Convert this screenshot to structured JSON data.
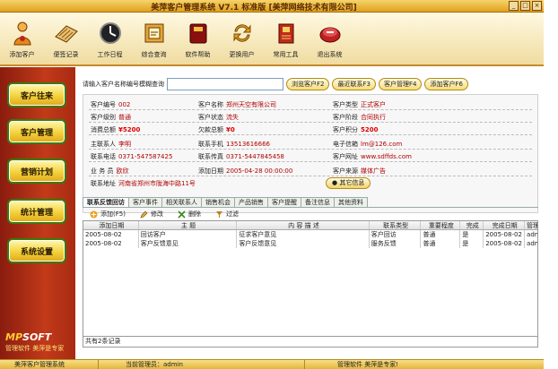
{
  "window": {
    "title": "美萍客户管理系统 V7.1 标准版 [美萍网络技术有限公司]",
    "controls": [
      "_",
      "□",
      "×"
    ]
  },
  "toolbar": [
    {
      "label": "添加客户",
      "icon": "person-icon"
    },
    {
      "label": "便签记录",
      "icon": "memo-icon"
    },
    {
      "label": "工作日程",
      "icon": "schedule-icon"
    },
    {
      "label": "综合查询",
      "icon": "query-icon"
    },
    {
      "label": "软件帮助",
      "icon": "help-book-icon"
    },
    {
      "label": "更换用户",
      "icon": "switch-user-icon"
    },
    {
      "label": "常用工具",
      "icon": "tools-icon"
    },
    {
      "label": "退出系统",
      "icon": "exit-icon"
    }
  ],
  "nav": [
    "客户往来",
    "客户管理",
    "营销计划",
    "统计管理",
    "系统设置"
  ],
  "logo": {
    "brand_mp": "MP",
    "brand_soft": "SOFT",
    "slogan": "管理软件 美萍是专家"
  },
  "search": {
    "label": "请输入客户名称编号模糊查询",
    "value": "",
    "buttons": [
      "浏览客户F2",
      "最近联系F3",
      "客户管理F4",
      "添加客户F6"
    ]
  },
  "customer": {
    "code_k": "客户编号",
    "code_v": "002",
    "name_k": "客户名称",
    "name_v": "郑州天空有限公司",
    "type_k": "客户类型",
    "type_v": "正式客户",
    "level_k": "客户级别",
    "level_v": "普通",
    "status_k": "客户状态",
    "status_v": "流失",
    "stage_k": "客户阶段",
    "stage_v": "合同执行",
    "spend_k": "消费总额",
    "spend_v": "¥5200",
    "owe_k": "欠款总额",
    "owe_v": "¥0",
    "points_k": "客户积分",
    "points_v": "5200",
    "contact_k": "主联系人",
    "contact_v": "李明",
    "phone_k": "联系手机",
    "phone_v": "13513616666",
    "email_k": "电子信箱",
    "email_v": "lm@126.com",
    "tel_k": "联系电话",
    "tel_v": "0371-547587425",
    "fax_k": "联系传真",
    "fax_v": "0371-5447845458",
    "web_k": "客户网址",
    "web_v": "www.sdffds.com",
    "sales_k": "业 务 员",
    "sales_v": "欧欣",
    "date_k": "添加日期",
    "date_v": "2005-04-28 00:00:00",
    "source_k": "客户来源",
    "source_v": "媒体广告",
    "addr_k": "联系地址",
    "addr_v": "河南省郑州市陇海中路11号",
    "other_btn": "其它信息"
  },
  "tabs": [
    "联系反馈回访",
    "客户事件",
    "相关联系人",
    "销售机会",
    "产品销售",
    "客户提醒",
    "备注信息",
    "其他资料"
  ],
  "grid_tools": [
    {
      "label": "添加(F5)",
      "icon": "add-icon"
    },
    {
      "label": "修改",
      "icon": "edit-icon"
    },
    {
      "label": "删除",
      "icon": "delete-icon"
    },
    {
      "label": "过滤",
      "icon": "filter-icon"
    }
  ],
  "grid": {
    "columns": [
      "添加日期",
      "主  题",
      "内 容 描 述",
      "联系类型",
      "重要程度",
      "完成",
      "完成日期",
      "管理"
    ],
    "rows": [
      [
        "2005-08-02",
        "回访客户",
        "征求客户意见",
        "客户回访",
        "普通",
        "是",
        "2005-08-02",
        "admin"
      ],
      [
        "2005-08-02",
        "客户反馈意见",
        "客户反馈意见",
        "服务反馈",
        "普通",
        "是",
        "2005-08-02",
        "admin"
      ]
    ],
    "footer": "共有2条记录"
  },
  "statusbar": [
    "美萍客户管理系统",
    "当前管理员：admin",
    "管理软件 美萍是专家!"
  ]
}
